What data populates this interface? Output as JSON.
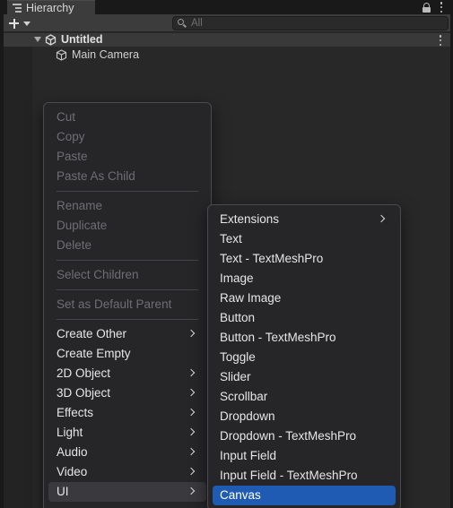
{
  "window": {
    "tab_title": "Hierarchy",
    "tab_icon": "hierarchy-list-icon",
    "search_placeholder": "All"
  },
  "scene": {
    "name": "Untitled",
    "objects": [
      {
        "name": "Main Camera",
        "icon": "cube-icon"
      }
    ]
  },
  "context_menu": {
    "items": [
      {
        "label": "Cut",
        "enabled": false
      },
      {
        "label": "Copy",
        "enabled": false
      },
      {
        "label": "Paste",
        "enabled": false
      },
      {
        "label": "Paste As Child",
        "enabled": false
      },
      {
        "label": "Rename",
        "enabled": false
      },
      {
        "label": "Duplicate",
        "enabled": false
      },
      {
        "label": "Delete",
        "enabled": false
      },
      {
        "label": "Select Children",
        "enabled": false
      },
      {
        "label": "Set as Default Parent",
        "enabled": false
      },
      {
        "label": "Create Other",
        "enabled": true,
        "submenu": true
      },
      {
        "label": "Create Empty",
        "enabled": true
      },
      {
        "label": "2D Object",
        "enabled": true,
        "submenu": true
      },
      {
        "label": "3D Object",
        "enabled": true,
        "submenu": true
      },
      {
        "label": "Effects",
        "enabled": true,
        "submenu": true
      },
      {
        "label": "Light",
        "enabled": true,
        "submenu": true
      },
      {
        "label": "Audio",
        "enabled": true,
        "submenu": true
      },
      {
        "label": "Video",
        "enabled": true,
        "submenu": true
      },
      {
        "label": "UI",
        "enabled": true,
        "submenu": true,
        "hovered": true
      }
    ]
  },
  "ui_submenu": {
    "items": [
      {
        "label": "Extensions",
        "submenu": true
      },
      {
        "label": "Text"
      },
      {
        "label": "Text - TextMeshPro"
      },
      {
        "label": "Image"
      },
      {
        "label": "Raw Image"
      },
      {
        "label": "Button"
      },
      {
        "label": "Button - TextMeshPro"
      },
      {
        "label": "Toggle"
      },
      {
        "label": "Slider"
      },
      {
        "label": "Scrollbar"
      },
      {
        "label": "Dropdown"
      },
      {
        "label": "Dropdown - TextMeshPro"
      },
      {
        "label": "Input Field"
      },
      {
        "label": "Input Field - TextMeshPro"
      },
      {
        "label": "Canvas",
        "selected": true
      }
    ]
  },
  "colors": {
    "selection": "#1f5bb3",
    "menu_background": "#262629",
    "panel_background": "#282828"
  }
}
